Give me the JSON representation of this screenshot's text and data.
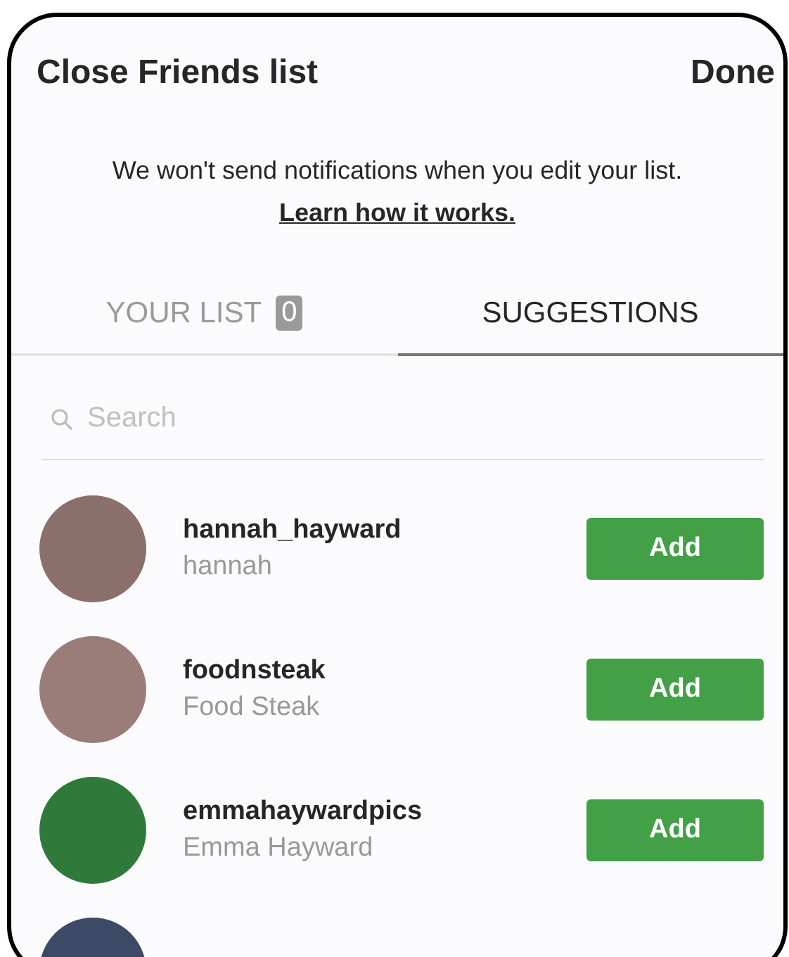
{
  "header": {
    "title": "Close Friends list",
    "done": "Done"
  },
  "notice": {
    "text": "We won't send notifications when you edit your list.",
    "link": "Learn how it works."
  },
  "tabs": [
    {
      "label": "YOUR LIST",
      "badge": "0",
      "selected": false
    },
    {
      "label": "SUGGESTIONS",
      "selected": true
    }
  ],
  "search": {
    "placeholder": "Search"
  },
  "suggestions": [
    {
      "username": "hannah_hayward",
      "name": "hannah",
      "button": "Add"
    },
    {
      "username": "foodnsteak",
      "name": "Food Steak",
      "button": "Add"
    },
    {
      "username": "emmahaywardpics",
      "name": "Emma Hayward",
      "button": "Add"
    }
  ]
}
